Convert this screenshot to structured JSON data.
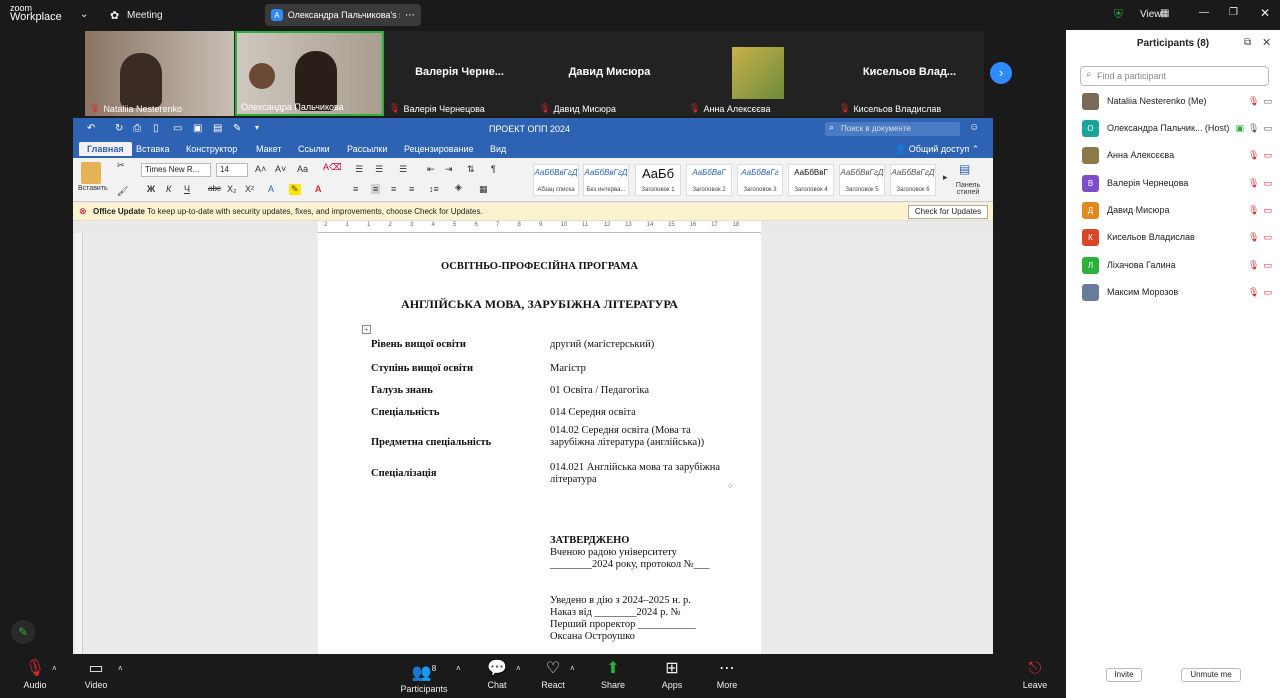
{
  "topbar": {
    "logo_top": "zoom",
    "logo_bottom": "Workplace",
    "meeting_label": "Meeting",
    "share_avatar": "A",
    "share_label": "Олександра Пальчикова's scree",
    "view_label": "View"
  },
  "video": {
    "tiles": [
      {
        "name": "Nataliia Nesterenko",
        "big": ""
      },
      {
        "name": "Олександра Пальчикова",
        "big": ""
      },
      {
        "name": "Валерія Чернецова",
        "big": "Валерія  Черне..."
      },
      {
        "name": "Давид Мисюра",
        "big": "Давид Мисюра"
      },
      {
        "name": "Анна Алексєєва",
        "big": ""
      },
      {
        "name": "Кисельов Владислав",
        "big": "Кисельов  Влад..."
      }
    ]
  },
  "word": {
    "doc_title": "ПРОЕКТ ОПП 2024",
    "search_placeholder": "Поиск в документе",
    "tabs": [
      "Главная",
      "Вставка",
      "Конструктор",
      "Макет",
      "Ссылки",
      "Рассылки",
      "Рецензирование",
      "Вид"
    ],
    "share_btn": "Общий доступ",
    "paste_label": "Вставить",
    "font_name": "Times New R...",
    "font_size": "14",
    "styles": [
      {
        "preview": "АаБбВвГгД",
        "label": "Абзац списка"
      },
      {
        "preview": "АаБбВвГгД",
        "label": "Без интерва..."
      },
      {
        "preview": "АаБб",
        "label": "Заголовок 1"
      },
      {
        "preview": "АаБбВвГ",
        "label": "Заголовок 2"
      },
      {
        "preview": "АаБбВвГг",
        "label": "Заголовок 3"
      },
      {
        "preview": "АаБбВвГ",
        "label": "Заголовок 4"
      },
      {
        "preview": "АаБбВвГгД",
        "label": "Заголовок 5"
      },
      {
        "preview": "АаБбВвГгД",
        "label": "Заголовок 6"
      }
    ],
    "styles_pane": "Панель стилей",
    "update": {
      "title": "Office Update",
      "message": "To keep up-to-date with security updates, fixes, and improvements, choose Check for Updates.",
      "button": "Check for Updates"
    },
    "ruler_ticks": [
      "2",
      "1",
      "1",
      "2",
      "3",
      "4",
      "5",
      "6",
      "7",
      "8",
      "9",
      "10",
      "11",
      "12",
      "13",
      "14",
      "15",
      "16",
      "17",
      "18"
    ]
  },
  "document": {
    "heading1": "ОСВІТНЬО-ПРОФЕСІЙНА ПРОГРАМА",
    "heading2": "АНГЛІЙСЬКА МОВА, ЗАРУБІЖНА ЛІТЕРАТУРА",
    "rows": [
      {
        "label": "Рівень вищої освіти",
        "value": "другий (магістерський)"
      },
      {
        "label": "Ступінь вищої освіти",
        "value": "Магістр"
      },
      {
        "label": "Галузь знань",
        "value": "01 Освіта / Педагогіка"
      },
      {
        "label": "Спеціальність",
        "value": "014 Середня освіта"
      },
      {
        "label": "Предметна спеціальність",
        "value": "014.02 Середня освіта (Мова та зарубіжна література (англійська))"
      },
      {
        "label": "Спеціалізація",
        "value": "014.021 Англійська мова та зарубіжна література"
      }
    ],
    "approved_title": "ЗАТВЕРДЖЕНО",
    "approved_line1": "Вченою радою університету",
    "approved_line2": "________2024 року, протокол №___",
    "enact_line1": "Уведено в дію з 2024–2025 н. р.",
    "enact_line2": "Наказ від ________2024 р. №",
    "enact_line3": "Перший проректор ___________",
    "enact_line4": "Оксана Остроушко"
  },
  "bottombar": {
    "audio": "Audio",
    "video": "Video",
    "participants": "Participants",
    "participants_count": "8",
    "chat": "Chat",
    "react": "React",
    "share": "Share",
    "apps": "Apps",
    "more": "More",
    "leave": "Leave"
  },
  "panel": {
    "title": "Participants (8)",
    "search_placeholder": "Find a participant",
    "participants": [
      {
        "name": "Nataliia Nesterenko (Me)",
        "avatar": "",
        "color": "#7a6a5a"
      },
      {
        "name": "Олександра Пальчик... (Host)",
        "avatar": "О",
        "color": "#1aa39a"
      },
      {
        "name": "Анна Алексєєва",
        "avatar": "",
        "color": "#8a7a4a"
      },
      {
        "name": "Валерія Чернецова",
        "avatar": "В",
        "color": "#7b4fc9"
      },
      {
        "name": "Давид Мисюра",
        "avatar": "Д",
        "color": "#e08a1e"
      },
      {
        "name": "Кисельов Владислав",
        "avatar": "К",
        "color": "#d8452a"
      },
      {
        "name": "Ліхачова Галина",
        "avatar": "Л",
        "color": "#2eae3b"
      },
      {
        "name": "Максим Морозов",
        "avatar": "",
        "color": "#6a7a9a"
      }
    ],
    "invite": "Invite",
    "unmute": "Unmute me"
  }
}
